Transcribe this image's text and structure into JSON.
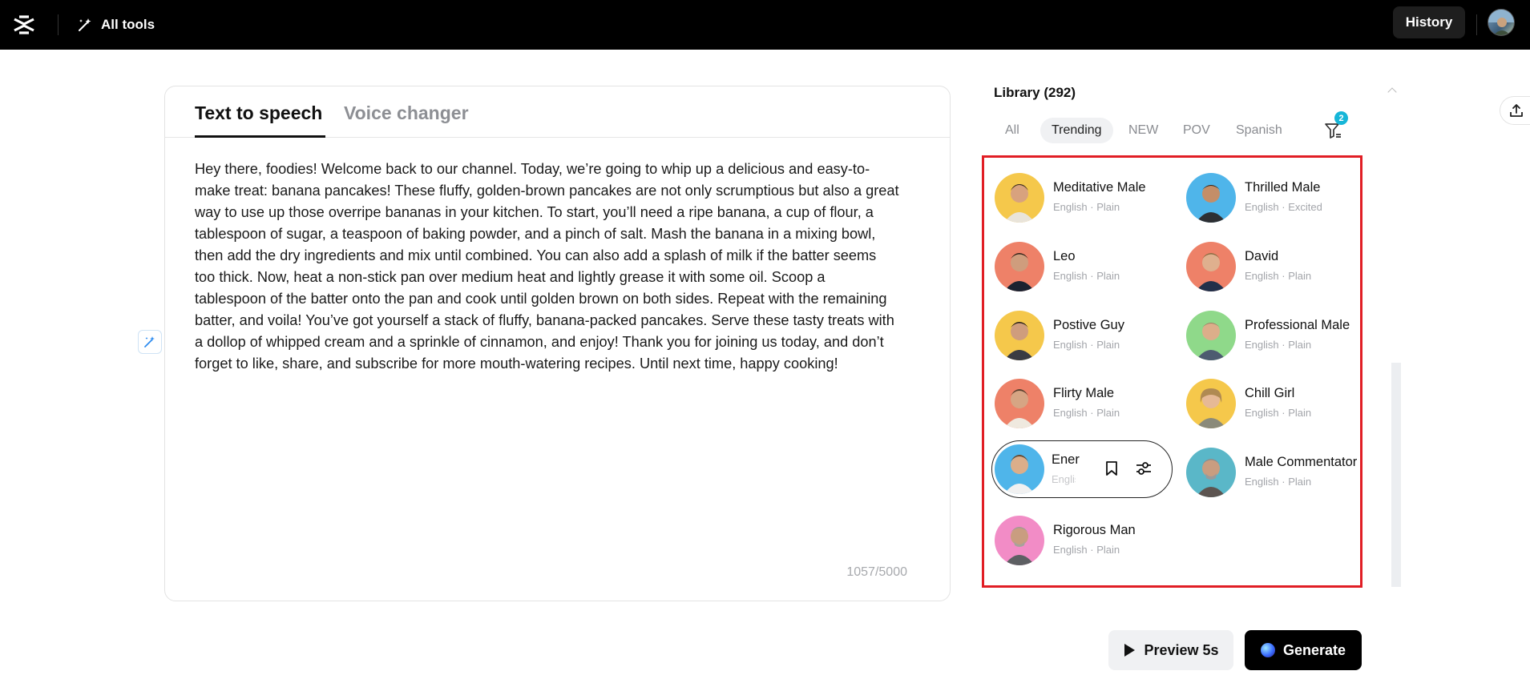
{
  "topbar": {
    "logo_icon": "capcut-logo-icon",
    "all_tools_label": "All tools",
    "history_label": "History"
  },
  "editor": {
    "tabs": [
      {
        "label": "Text to speech",
        "active": true
      },
      {
        "label": "Voice changer",
        "active": false
      }
    ],
    "script_lines": [
      "Hey there, foodies! Welcome back to our channel. Today, we’re going to whip up a delicious and easy-to-",
      "make treat: banana pancakes! These fluffy, golden-brown pancakes are not only scrumptious but also a great",
      "way to use up those overripe bananas in your kitchen. To start, you’ll need a ripe banana, a cup of flour, a",
      "tablespoon of sugar, a teaspoon of baking powder, and a pinch of salt. Mash the banana in a mixing bowl,",
      "then add the dry ingredients and mix until combined. You can also add a splash of milk if the batter seems",
      "too thick. Now, heat a non-stick pan over medium heat and lightly grease it with some oil. Scoop a",
      "tablespoon of the batter onto the pan and cook until golden brown on both sides. Repeat with the remaining",
      "batter, and voila! You’ve got yourself a stack of fluffy, banana-packed pancakes. Serve these tasty treats with",
      "a dollop of whipped cream and a sprinkle of cinnamon, and enjoy! Thank you for joining us today, and don’t",
      "forget to like, share, and subscribe for more mouth-watering recipes. Until next time, happy cooking!"
    ],
    "counter": "1057/5000"
  },
  "library": {
    "title": "Library (292)",
    "filters": [
      "All",
      "Trending",
      "NEW",
      "POV",
      "Spanish",
      "F"
    ],
    "active_filter": "Trending",
    "filter_badge": "2",
    "voices": [
      {
        "name": "Meditative Male",
        "meta": "English · Plain",
        "bg": "#f5c84b"
      },
      {
        "name": "Thrilled Male",
        "meta": "English · Excited",
        "bg": "#4fb5ea"
      },
      {
        "name": "Leo",
        "meta": "English · Plain",
        "bg": "#ee8168"
      },
      {
        "name": "David",
        "meta": "English · Plain",
        "bg": "#ee8168"
      },
      {
        "name": "Postive Guy",
        "meta": "English · Plain",
        "bg": "#f5c84b"
      },
      {
        "name": "Professional Male",
        "meta": "English · Plain",
        "bg": "#8fd98a"
      },
      {
        "name": "Flirty Male",
        "meta": "English · Plain",
        "bg": "#ee8168"
      },
      {
        "name": "Chill Girl",
        "meta": "English · Plain",
        "bg": "#f5c84b"
      },
      {
        "name": "Ener",
        "meta": "Englis",
        "bg": "#4fb5ea"
      },
      {
        "name": "Male Commentator",
        "meta": "English · Plain",
        "bg": "#5ab7c8"
      },
      {
        "name": "Rigorous Man",
        "meta": "English · Plain",
        "bg": "#f28cc6"
      }
    ]
  },
  "actions": {
    "preview_label": "Preview 5s",
    "generate_label": "Generate"
  }
}
